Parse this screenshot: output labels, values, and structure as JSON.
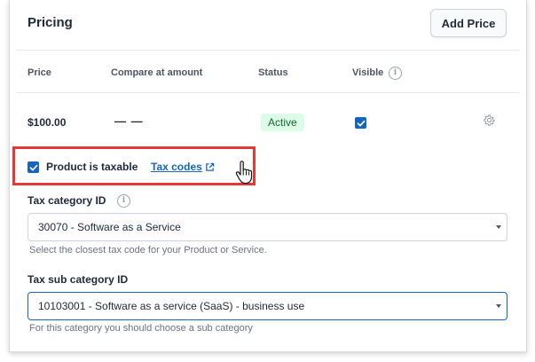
{
  "pricing": {
    "title": "Pricing",
    "add_price_label": "Add Price",
    "columns": {
      "price": "Price",
      "compare": "Compare at amount",
      "status": "Status",
      "visible": "Visible"
    },
    "row": {
      "price": "$100.00",
      "compare": "— —",
      "status": "Active",
      "visible_checked": true
    }
  },
  "tax": {
    "taxable_label": "Product is taxable",
    "taxable_checked": true,
    "tax_codes_link": "Tax codes",
    "category_label": "Tax category ID",
    "category_value": "30070 - Software as a Service",
    "category_help": "Select the closest tax code for your Product or Service.",
    "sub_category_label": "Tax sub category ID",
    "sub_category_value": "10103001 - Software as a service (SaaS) - business use",
    "sub_category_help": "For this category you should choose a sub category"
  },
  "colors": {
    "accent": "#1565c0",
    "highlight": "#e53935",
    "active_badge_bg": "#dcfce7",
    "active_badge_text": "#166534"
  },
  "icons": [
    "info-icon",
    "gear-icon",
    "external-link-icon",
    "hand-pointer-cursor-icon",
    "checkmark-icon",
    "caret-down-icon"
  ]
}
